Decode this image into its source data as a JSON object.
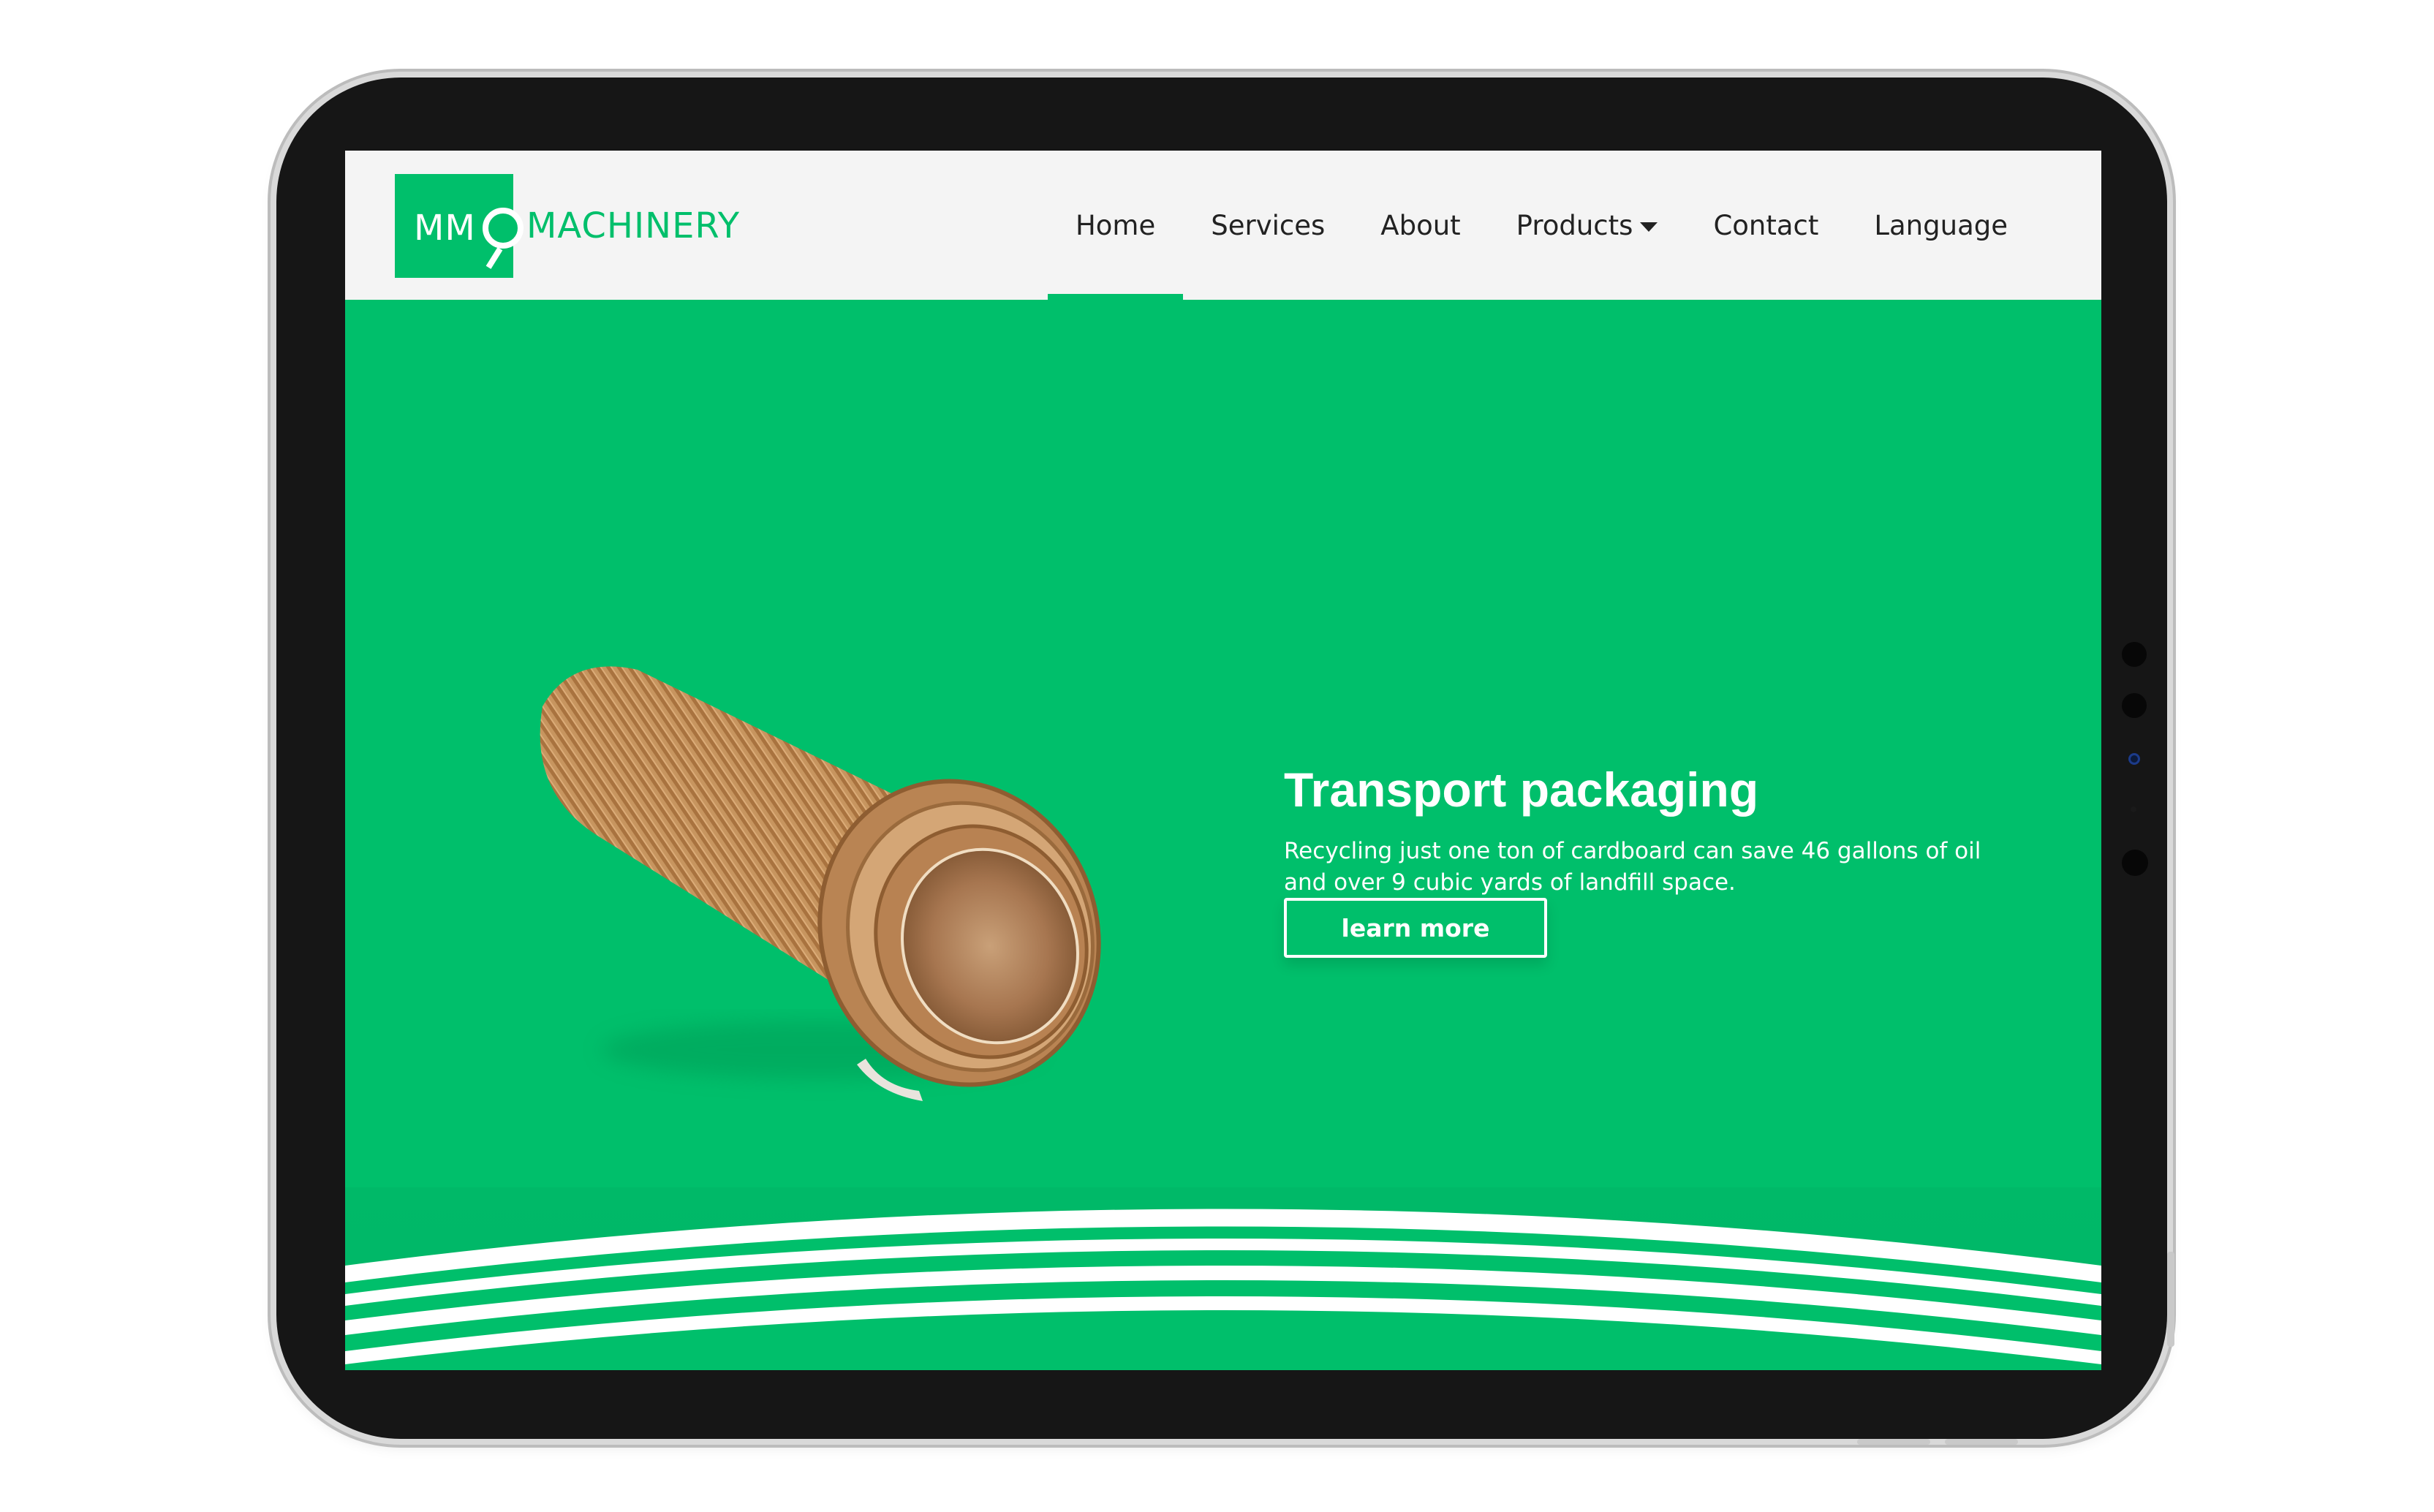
{
  "brand": {
    "logo_mark": "MM",
    "name": "MACHINERY",
    "accent_color": "#00bf6b"
  },
  "nav": {
    "items": [
      {
        "label": "Home",
        "active": true
      },
      {
        "label": "Services",
        "active": false
      },
      {
        "label": "About",
        "active": false
      },
      {
        "label": "Products",
        "active": false,
        "has_dropdown": true,
        "icon": "caret-down-icon"
      },
      {
        "label": "Contact",
        "active": false
      },
      {
        "label": "Language",
        "active": false
      }
    ]
  },
  "hero": {
    "title": "Transport packaging",
    "text": "Recycling just one ton of cardboard can save 46 gallons of oil and over 9 cubic yards of landfill space.",
    "button_label": "learn more",
    "image": "corrugated-cardboard-roll"
  }
}
